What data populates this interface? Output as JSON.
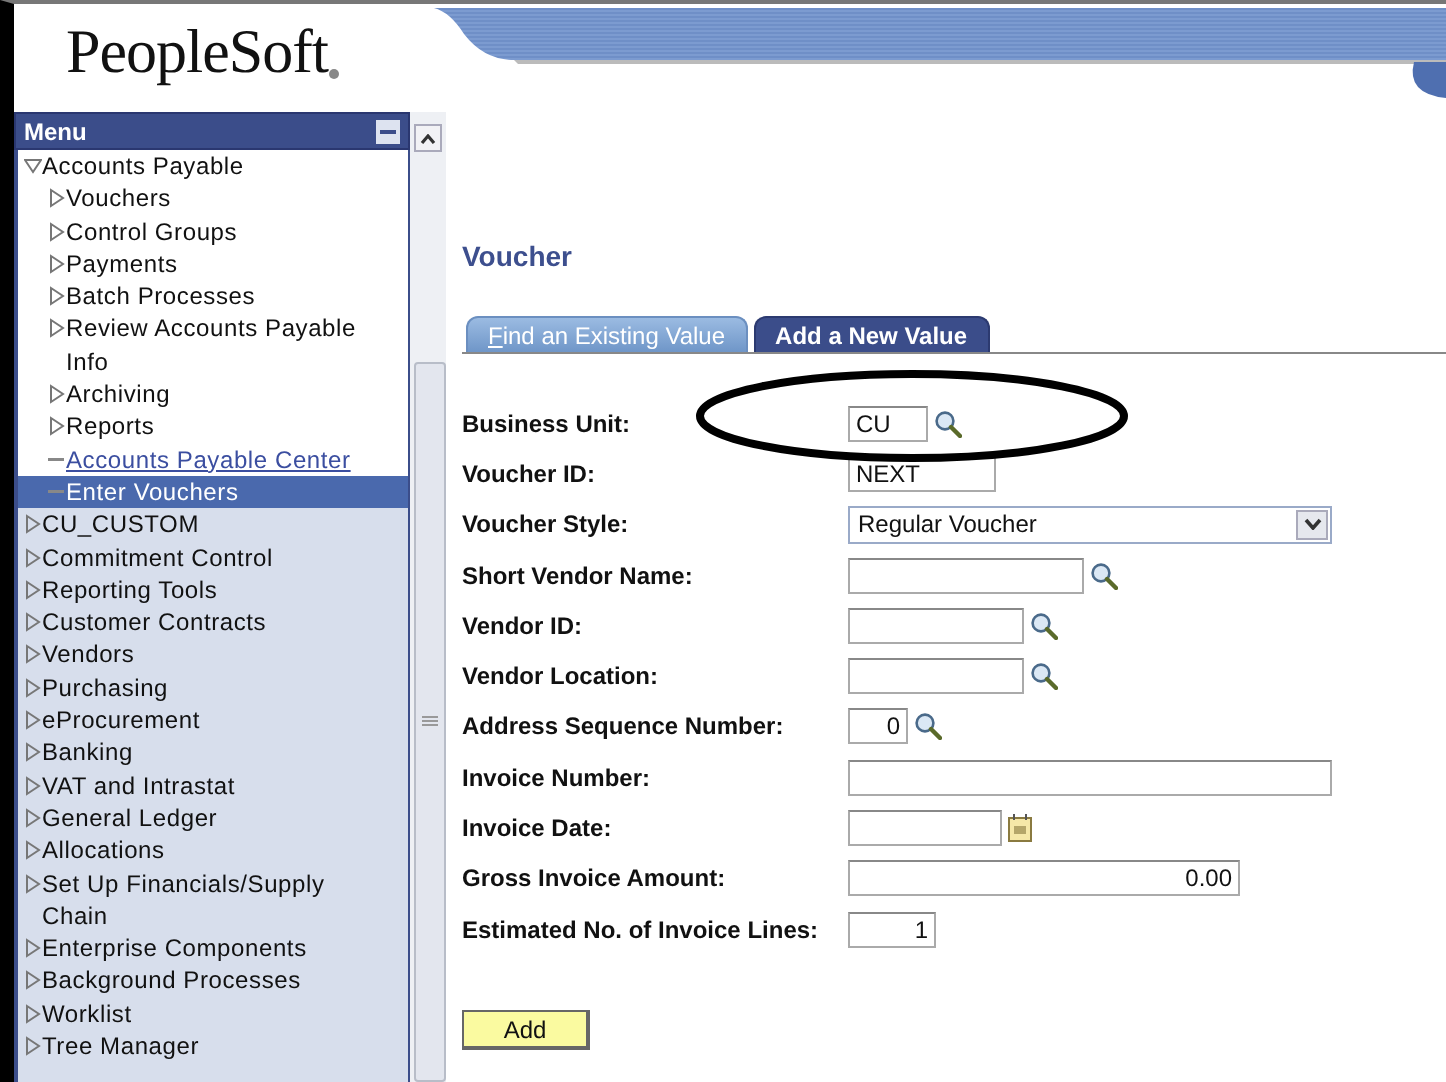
{
  "header": {
    "logo": "PeopleSoft"
  },
  "menu": {
    "title": "Menu",
    "items": [
      {
        "label": "Accounts Payable",
        "kind": "folder",
        "expanded": true,
        "selected": false,
        "children": [
          {
            "label": "Vouchers",
            "kind": "folder",
            "expanded": false,
            "selected": false
          },
          {
            "label": "Control Groups",
            "kind": "folder",
            "expanded": false,
            "selected": false
          },
          {
            "label": "Payments",
            "kind": "folder",
            "expanded": false,
            "selected": false
          },
          {
            "label": "Batch Processes",
            "kind": "folder",
            "expanded": false,
            "selected": false
          },
          {
            "label": "Review Accounts Payable Info",
            "kind": "folder",
            "expanded": false,
            "selected": false
          },
          {
            "label": "Archiving",
            "kind": "folder",
            "expanded": false,
            "selected": false
          },
          {
            "label": "Reports",
            "kind": "folder",
            "expanded": false,
            "selected": false
          },
          {
            "label": "Accounts Payable Center",
            "kind": "link",
            "selected": false
          },
          {
            "label": "Enter Vouchers",
            "kind": "link",
            "selected": true
          }
        ]
      },
      {
        "label": "CU_CUSTOM",
        "kind": "folder",
        "expanded": false,
        "selected": false
      },
      {
        "label": "Commitment Control",
        "kind": "folder",
        "expanded": false,
        "selected": false
      },
      {
        "label": "Reporting Tools",
        "kind": "folder",
        "expanded": false,
        "selected": false
      },
      {
        "label": "Customer Contracts",
        "kind": "folder",
        "expanded": false,
        "selected": false
      },
      {
        "label": "Vendors",
        "kind": "folder",
        "expanded": false,
        "selected": false
      },
      {
        "label": "Purchasing",
        "kind": "folder",
        "expanded": false,
        "selected": false
      },
      {
        "label": "eProcurement",
        "kind": "folder",
        "expanded": false,
        "selected": false
      },
      {
        "label": "Banking",
        "kind": "folder",
        "expanded": false,
        "selected": false
      },
      {
        "label": "VAT and Intrastat",
        "kind": "folder",
        "expanded": false,
        "selected": false
      },
      {
        "label": "General Ledger",
        "kind": "folder",
        "expanded": false,
        "selected": false
      },
      {
        "label": "Allocations",
        "kind": "folder",
        "expanded": false,
        "selected": false
      },
      {
        "label": "Set Up Financials/Supply Chain",
        "kind": "folder",
        "expanded": false,
        "selected": false
      },
      {
        "label": "Enterprise Components",
        "kind": "folder",
        "expanded": false,
        "selected": false
      },
      {
        "label": "Background Processes",
        "kind": "folder",
        "expanded": false,
        "selected": false
      },
      {
        "label": "Worklist",
        "kind": "folder",
        "expanded": false,
        "selected": false
      },
      {
        "label": "Tree Manager",
        "kind": "folder",
        "expanded": false,
        "selected": false
      }
    ]
  },
  "page": {
    "title": "Voucher",
    "tabs": [
      {
        "label": "Find an Existing Value",
        "selected": false
      },
      {
        "label": "Add a New Value",
        "selected": true
      }
    ],
    "fields": [
      {
        "label": "Business Unit:",
        "kind": "lookup",
        "value": "CU"
      },
      {
        "label": "Voucher ID:",
        "kind": "text",
        "value": "NEXT"
      },
      {
        "label": "Voucher Style:",
        "kind": "select",
        "value": "Regular Voucher"
      },
      {
        "label": "Short Vendor Name:",
        "kind": "lookup"
      },
      {
        "label": "Vendor ID:",
        "kind": "lookup"
      },
      {
        "label": "Vendor Location:",
        "kind": "lookup"
      },
      {
        "label": "Address Sequence Number:",
        "kind": "lookup",
        "value": "0"
      },
      {
        "label": "Invoice Number:",
        "kind": "text"
      },
      {
        "label": "Invoice Date:",
        "kind": "date"
      },
      {
        "label": "Gross Invoice Amount:",
        "kind": "text",
        "value": "0.00"
      },
      {
        "label": "Estimated No. of Invoice Lines:",
        "kind": "text",
        "value": "1"
      }
    ],
    "button": "Add"
  }
}
